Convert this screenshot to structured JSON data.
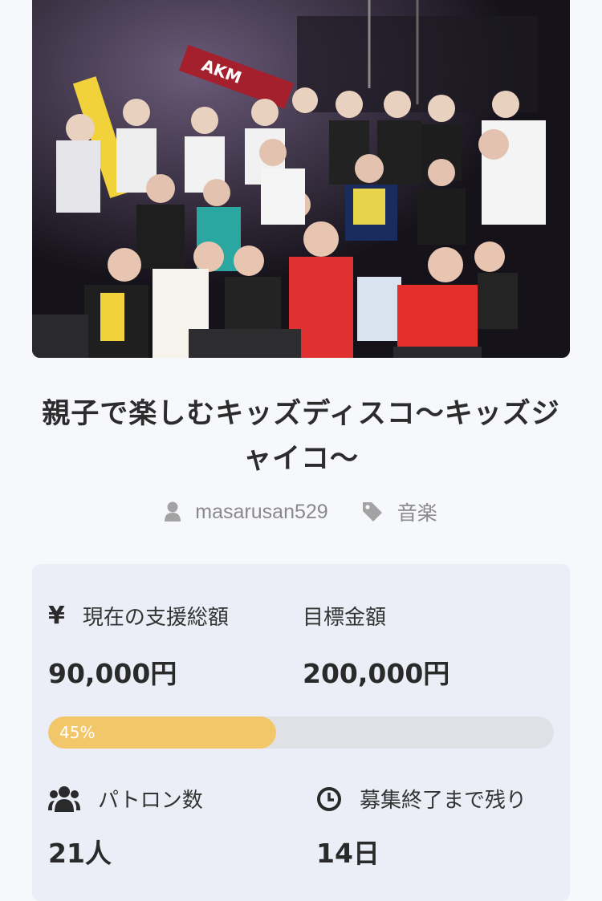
{
  "project": {
    "title": "親子で楽しむキッズディスコ〜キッズジャイコ〜",
    "owner": "masarusan529",
    "category": "音楽",
    "banner_text": "AKM"
  },
  "stats": {
    "current_label": "現在の支援総額",
    "current_value": "90,000円",
    "target_label": "目標金額",
    "target_value": "200,000円",
    "progress_percent": 45,
    "progress_label": "45%",
    "patrons_label": "パトロン数",
    "patrons_value": "21人",
    "remaining_label": "募集終了まで残り",
    "remaining_value": "14日"
  },
  "icons": {
    "owner": "user-icon",
    "category": "tag-icon",
    "current": "yen-icon",
    "patrons": "users-icon",
    "remaining": "clock-icon"
  },
  "colors": {
    "progress_fill": "#f2c76a",
    "progress_track": "#e0e1e6",
    "card_bg": "#ebeef6",
    "page_bg": "#f7f8fc"
  }
}
